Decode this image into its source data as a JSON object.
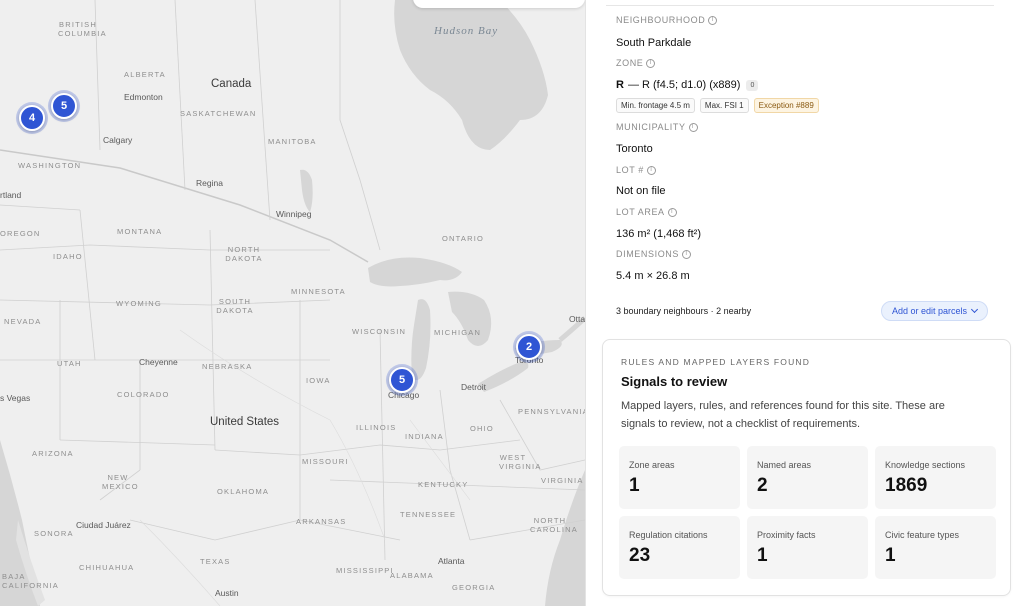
{
  "map": {
    "labels": {
      "british_columbia": "BRITISH COLUMBIA",
      "alberta": "ALBERTA",
      "saskatchewan": "SASKATCHEWAN",
      "manitoba": "MANITOBA",
      "ontario": "ONTARIO",
      "canada": "Canada",
      "hudson_bay": "Hudson Bay",
      "edmonton": "Edmonton",
      "calgary": "Calgary",
      "regina": "Regina",
      "winnipeg": "Winnipeg",
      "washington": "WASHINGTON",
      "portland": "rtland",
      "oregon": "OREGON",
      "montana": "MONTANA",
      "idaho": "IDAHO",
      "north_dakota": "NORTH DAKOTA",
      "south_dakota": "SOUTH DAKOTA",
      "minnesota": "MINNESOTA",
      "wyoming": "WYOMING",
      "nevada": "NEVADA",
      "utah": "UTAH",
      "cheyenne": "Cheyenne",
      "nebraska": "NEBRASKA",
      "iowa": "IOWA",
      "wisconsin": "WISCONSIN",
      "michigan": "MICHIGAN",
      "colorado": "COLORADO",
      "las_vegas": "s Vegas",
      "united_states": "United States",
      "illinois": "ILLINOIS",
      "indiana": "INDIANA",
      "ohio": "OHIO",
      "pennsylvania": "PENNSYLVANIA",
      "chicago": "Chicago",
      "detroit": "Detroit",
      "toronto": "Toronto",
      "ottawa": "Otta",
      "arizona": "ARIZONA",
      "new_mexico": "NEW MEXICO",
      "oklahoma": "OKLAHOMA",
      "missouri": "MISSOURI",
      "kentucky": "KENTUCKY",
      "west_virginia": "WEST VIRGINIA",
      "virginia": "VIRGINIA",
      "tennessee": "TENNESSEE",
      "north_carolina": "NORTH CAROLINA",
      "arkansas": "ARKANSAS",
      "sonora": "SONORA",
      "ciudad_juarez": "Ciudad Juárez",
      "chihuahua": "CHIHUAHUA",
      "texas": "TEXAS",
      "mississippi": "MISSISSIPPI",
      "alabama": "ALABAMA",
      "georgia": "GEORGIA",
      "atlanta": "Atlanta",
      "austin": "Austin",
      "baja_california": "BAJA CALIFORNIA"
    },
    "clusters": [
      {
        "count": "4"
      },
      {
        "count": "5"
      },
      {
        "count": "2"
      },
      {
        "count": "5"
      }
    ]
  },
  "panel": {
    "neighbourhood_label": "NEIGHBOURHOOD",
    "neighbourhood_value": "South Parkdale",
    "zone_label": "ZONE",
    "zone_code": "R",
    "zone_detail": "— R (f4.5; d1.0) (x889)",
    "zone_count": "0",
    "chips": [
      "Min. frontage 4.5 m",
      "Max. FSI 1",
      "Exception #889"
    ],
    "municipality_label": "MUNICIPALITY",
    "municipality_value": "Toronto",
    "lot_number_label": "LOT #",
    "lot_number_value": "Not on file",
    "lot_area_label": "LOT AREA",
    "lot_area_value": "136 m² (1,468 ft²)",
    "dimensions_label": "DIMENSIONS",
    "dimensions_value": "5.4 m × 26.8 m",
    "neighbours_text": "3 boundary neighbours · 2 nearby",
    "edit_parcels_label": "Add or edit parcels"
  },
  "signals": {
    "eyebrow": "RULES AND MAPPED LAYERS FOUND",
    "title": "Signals to review",
    "description": "Mapped layers, rules, and references found for this site. These are signals to review, not a checklist of requirements.",
    "stats": [
      {
        "label": "Zone areas",
        "value": "1"
      },
      {
        "label": "Named areas",
        "value": "2"
      },
      {
        "label": "Knowledge sections",
        "value": "1869"
      },
      {
        "label": "Regulation citations",
        "value": "23"
      },
      {
        "label": "Proximity facts",
        "value": "1"
      },
      {
        "label": "Civic feature types",
        "value": "1"
      }
    ]
  },
  "colors": {
    "accent": "#2f55d4",
    "map_land": "#efefef",
    "map_water": "#d4d4d4",
    "exception_chip": "#fdf4e2"
  }
}
